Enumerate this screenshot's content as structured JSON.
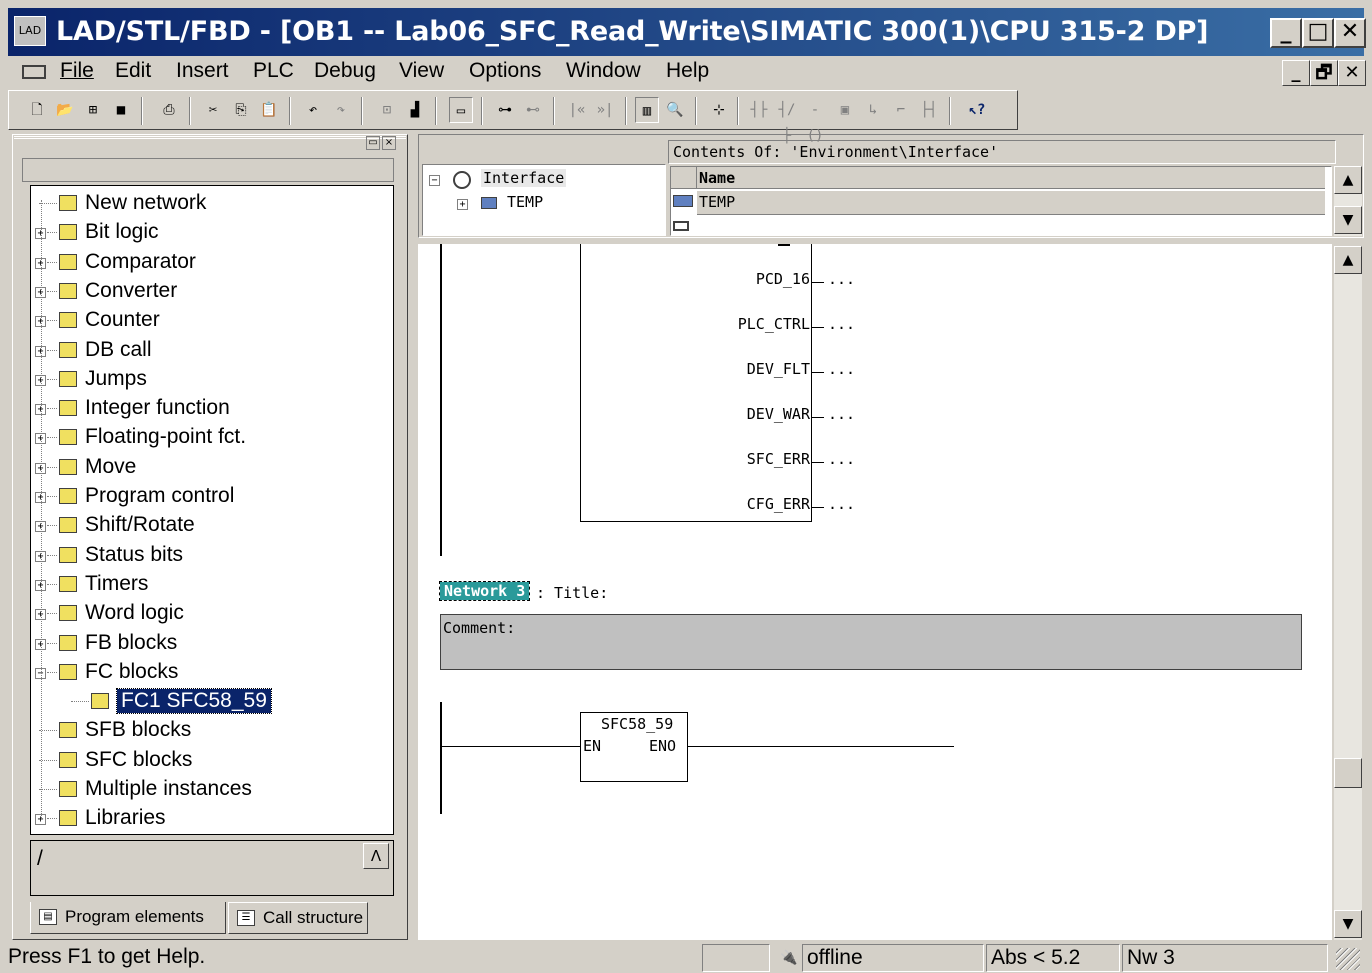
{
  "window": {
    "title": "LAD/STL/FBD  - [OB1 -- Lab06_SFC_Read_Write\\SIMATIC 300(1)\\CPU 315-2 DP]",
    "app_icon": "step7-app-icon",
    "controls": {
      "minimize": "_",
      "maximize": "□",
      "close": "✕"
    }
  },
  "menu": {
    "items": [
      "File",
      "Edit",
      "Insert",
      "PLC",
      "Debug",
      "View",
      "Options",
      "Window",
      "Help"
    ],
    "mdi_controls": {
      "minimize": "_",
      "restore": "🗗",
      "close": "✕"
    }
  },
  "toolbar": {
    "buttons": [
      "new",
      "open",
      "accessible-nodes",
      "save",
      "print",
      "cut",
      "copy",
      "paste",
      "undo",
      "redo",
      "monitor-lad",
      "monitor-fbd",
      "overview",
      "network",
      "network-off",
      "first",
      "last",
      "toggle-interface",
      "zoom",
      "new-network",
      "no-contact",
      "nc-contact",
      "coil",
      "box",
      "branch-open",
      "branch-close",
      "connection",
      "whats-this"
    ]
  },
  "program_elements": {
    "tree": [
      {
        "label": "New network",
        "icon": "new-network-icon",
        "expandable": false
      },
      {
        "label": "Bit logic",
        "icon": "bit-logic-icon",
        "expandable": true
      },
      {
        "label": "Comparator",
        "icon": "comparator-icon",
        "expandable": true
      },
      {
        "label": "Converter",
        "icon": "converter-icon",
        "expandable": true
      },
      {
        "label": "Counter",
        "icon": "counter-icon",
        "expandable": true
      },
      {
        "label": "DB call",
        "icon": "db-call-icon",
        "expandable": true
      },
      {
        "label": "Jumps",
        "icon": "jumps-icon",
        "expandable": true
      },
      {
        "label": "Integer function",
        "icon": "integer-function-icon",
        "expandable": true
      },
      {
        "label": "Floating-point fct.",
        "icon": "floating-point-icon",
        "expandable": true
      },
      {
        "label": "Move",
        "icon": "move-icon",
        "expandable": true
      },
      {
        "label": "Program control",
        "icon": "program-control-icon",
        "expandable": true
      },
      {
        "label": "Shift/Rotate",
        "icon": "shift-rotate-icon",
        "expandable": true
      },
      {
        "label": "Status bits",
        "icon": "status-bits-icon",
        "expandable": true
      },
      {
        "label": "Timers",
        "icon": "timers-icon",
        "expandable": true
      },
      {
        "label": "Word logic",
        "icon": "word-logic-icon",
        "expandable": true
      },
      {
        "label": "FB blocks",
        "icon": "fb-blocks-icon",
        "expandable": true
      },
      {
        "label": "FC blocks",
        "icon": "fc-blocks-icon",
        "expandable": true,
        "expanded": true
      },
      {
        "label": "FC1   SFC58_59",
        "icon": "fc-block-icon",
        "expandable": false,
        "child": true,
        "selected": true
      },
      {
        "label": "SFB blocks",
        "icon": "sfb-blocks-icon",
        "expandable": false
      },
      {
        "label": "SFC blocks",
        "icon": "sfc-blocks-icon",
        "expandable": false
      },
      {
        "label": "Multiple instances",
        "icon": "multiple-instances-icon",
        "expandable": false
      },
      {
        "label": "Libraries",
        "icon": "libraries-icon",
        "expandable": true
      }
    ],
    "path_text": "/",
    "tabs": [
      {
        "label": "Program elements",
        "icon": "program-elements-icon",
        "active": true
      },
      {
        "label": "Call structure",
        "icon": "call-structure-icon",
        "active": false
      }
    ]
  },
  "interface": {
    "contents_of": "Contents Of: 'Environment\\Interface'",
    "tree_root": "Interface",
    "tree_child": "TEMP",
    "column_header": "Name",
    "rows": [
      "TEMP",
      ""
    ]
  },
  "editor": {
    "block_outputs": [
      "PCD_16",
      "PLC_CTRL",
      "DEV_FLT",
      "DEV_WAR",
      "SFC_ERR",
      "CFG_ERR"
    ],
    "output_placeholder": "...",
    "network_label": "Network 3",
    "network_title": ": Title:",
    "comment_label": "Comment:",
    "call_block": {
      "name": "SFC58_59",
      "input": "EN",
      "output": "ENO"
    }
  },
  "statusbar": {
    "help": "Press F1 to get Help.",
    "mode": "offline",
    "abs": "Abs < 5.2",
    "network": "Nw 3"
  }
}
